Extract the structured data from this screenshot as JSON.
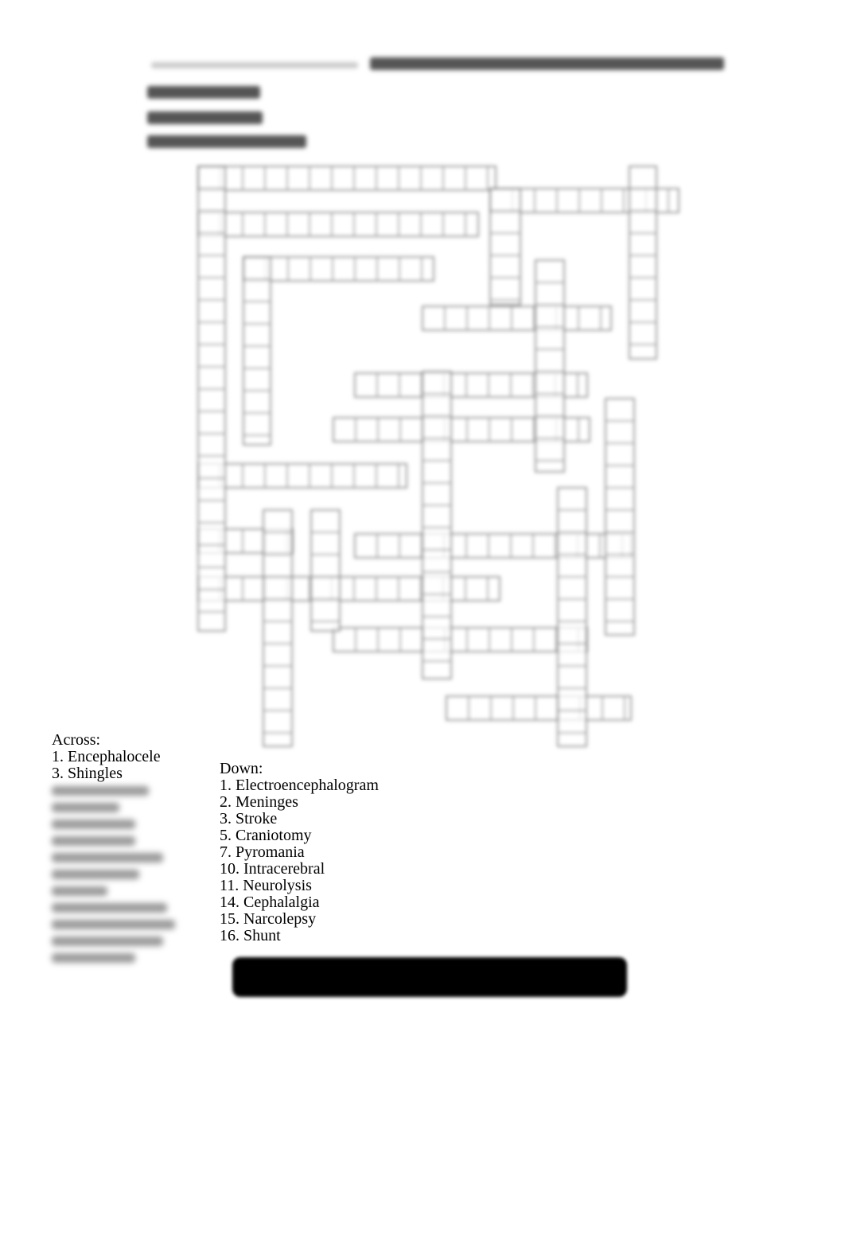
{
  "across": {
    "heading": "Across:",
    "items": [
      "1. Encephalocele",
      "3. Shingles"
    ]
  },
  "down": {
    "heading": "Down:",
    "items": [
      "1. Electroencephalogram",
      "2. Meninges",
      "3. Stroke",
      "5. Craniotomy",
      "7. Pyromania",
      "10. Intracerebral",
      "11. Neurolysis",
      "14. Cephalalgia",
      "15. Narcolepsy",
      "16. Shunt"
    ]
  }
}
